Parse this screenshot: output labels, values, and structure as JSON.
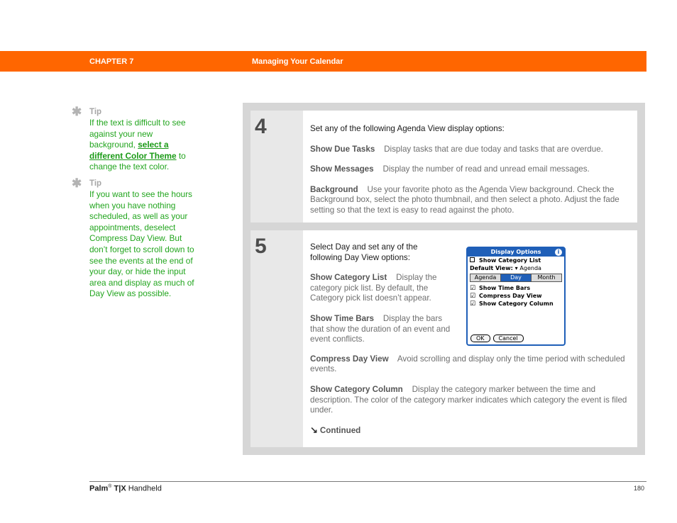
{
  "header": {
    "chapter": "CHAPTER 7",
    "title": "Managing Your Calendar",
    "bar_color": "#ff6600"
  },
  "sidebar": {
    "tips": [
      {
        "icon": "asterisk-icon",
        "label": "Tip",
        "text_before": "If the text is difficult to see against your new background, ",
        "link_text": "select a different Color Theme",
        "text_after": " to change the text color."
      },
      {
        "icon": "asterisk-icon",
        "label": "Tip",
        "text": "If you want to see the hours when you have nothing scheduled, as well as your appointments, deselect Compress Day View. But don’t forget to scroll down to see the events at the end of your day, or hide the input area and display as much of Day View as possible."
      }
    ]
  },
  "steps": [
    {
      "number": "4",
      "intro": "Set any of the following Agenda View display options:",
      "options": [
        {
          "term": "Show Due Tasks",
          "desc": "Display tasks that are due today and tasks that are overdue."
        },
        {
          "term": "Show Messages",
          "desc": "Display the number of read and unread email messages."
        },
        {
          "term": "Background",
          "desc": "Use your favorite photo as the Agenda View background. Check the Background box, select the photo thumbnail, and then select a photo. Adjust the fade setting so that the text is easy to read against the photo."
        }
      ]
    },
    {
      "number": "5",
      "intro": "Select Day and set any of the following Day View options:",
      "options": [
        {
          "term": "Show Category List",
          "desc": "Display the category pick list. By default, the Category pick list doesn’t appear."
        },
        {
          "term": "Show Time Bars",
          "desc": "Display the bars that show the duration of an event and event conflicts."
        },
        {
          "term": "Compress Day View",
          "desc": "Avoid scrolling and display only the time period with scheduled events."
        },
        {
          "term": "Show Category Column",
          "desc": "Display the category marker between the time and description. The color of the category marker indicates which category the event is filed under."
        }
      ],
      "continued": "Continued"
    }
  ],
  "screenshot": {
    "title": "Display Options",
    "show_category_list": "Show Category List",
    "show_category_list_checked": false,
    "default_view_label": "Default View:",
    "default_view_value": "Agenda",
    "tabs": [
      "Agenda",
      "Day",
      "Month"
    ],
    "active_tab": "Day",
    "checkboxes": [
      {
        "label": "Show Time Bars",
        "checked": true
      },
      {
        "label": "Compress Day View",
        "checked": true
      },
      {
        "label": "Show Category Column",
        "checked": true
      }
    ],
    "buttons": [
      "OK",
      "Cancel"
    ]
  },
  "footer": {
    "brand": "Palm",
    "reg": "®",
    "model": "T|X",
    "product": "Handheld",
    "page": "180"
  }
}
